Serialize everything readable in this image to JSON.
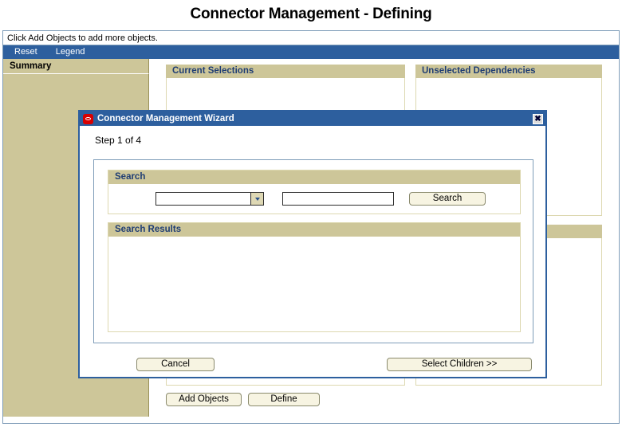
{
  "page": {
    "title": "Connector Management - Defining",
    "status_message": "Click Add Objects to add more objects."
  },
  "menu": {
    "items": [
      {
        "label": "Reset",
        "name": "menu-item-reset"
      },
      {
        "label": "Legend",
        "name": "menu-item-legend"
      }
    ]
  },
  "sidebar": {
    "header": "Summary"
  },
  "panels": {
    "current_selections": {
      "title": "Current Selections"
    },
    "unselected_dependencies": {
      "title": "Unselected Dependencies"
    },
    "secondary": {
      "title": ""
    }
  },
  "actions": {
    "add_objects_label": "Add Objects",
    "define_label": "Define"
  },
  "dialog": {
    "title": "Connector Management Wizard",
    "logo_icon": "oracle-logo-icon",
    "close_icon": "close-icon",
    "close_label": "✖",
    "step_label": "Step 1 of 4",
    "search": {
      "section_title": "Search",
      "dropdown_value": "",
      "dropdown_placeholder": "",
      "dropdown_icon": "chevron-down-icon",
      "text_value": "",
      "text_placeholder": "",
      "button_label": "Search"
    },
    "search_results": {
      "section_title": "Search Results",
      "rows": []
    },
    "footer": {
      "cancel_label": "Cancel",
      "next_label": "Select Children >>"
    }
  },
  "colors": {
    "accent_blue": "#2d5f9e",
    "panel_tan": "#cdc699",
    "header_text_blue": "#1f3d73",
    "button_face": "#f7f4e2",
    "logo_red": "#d80000"
  }
}
